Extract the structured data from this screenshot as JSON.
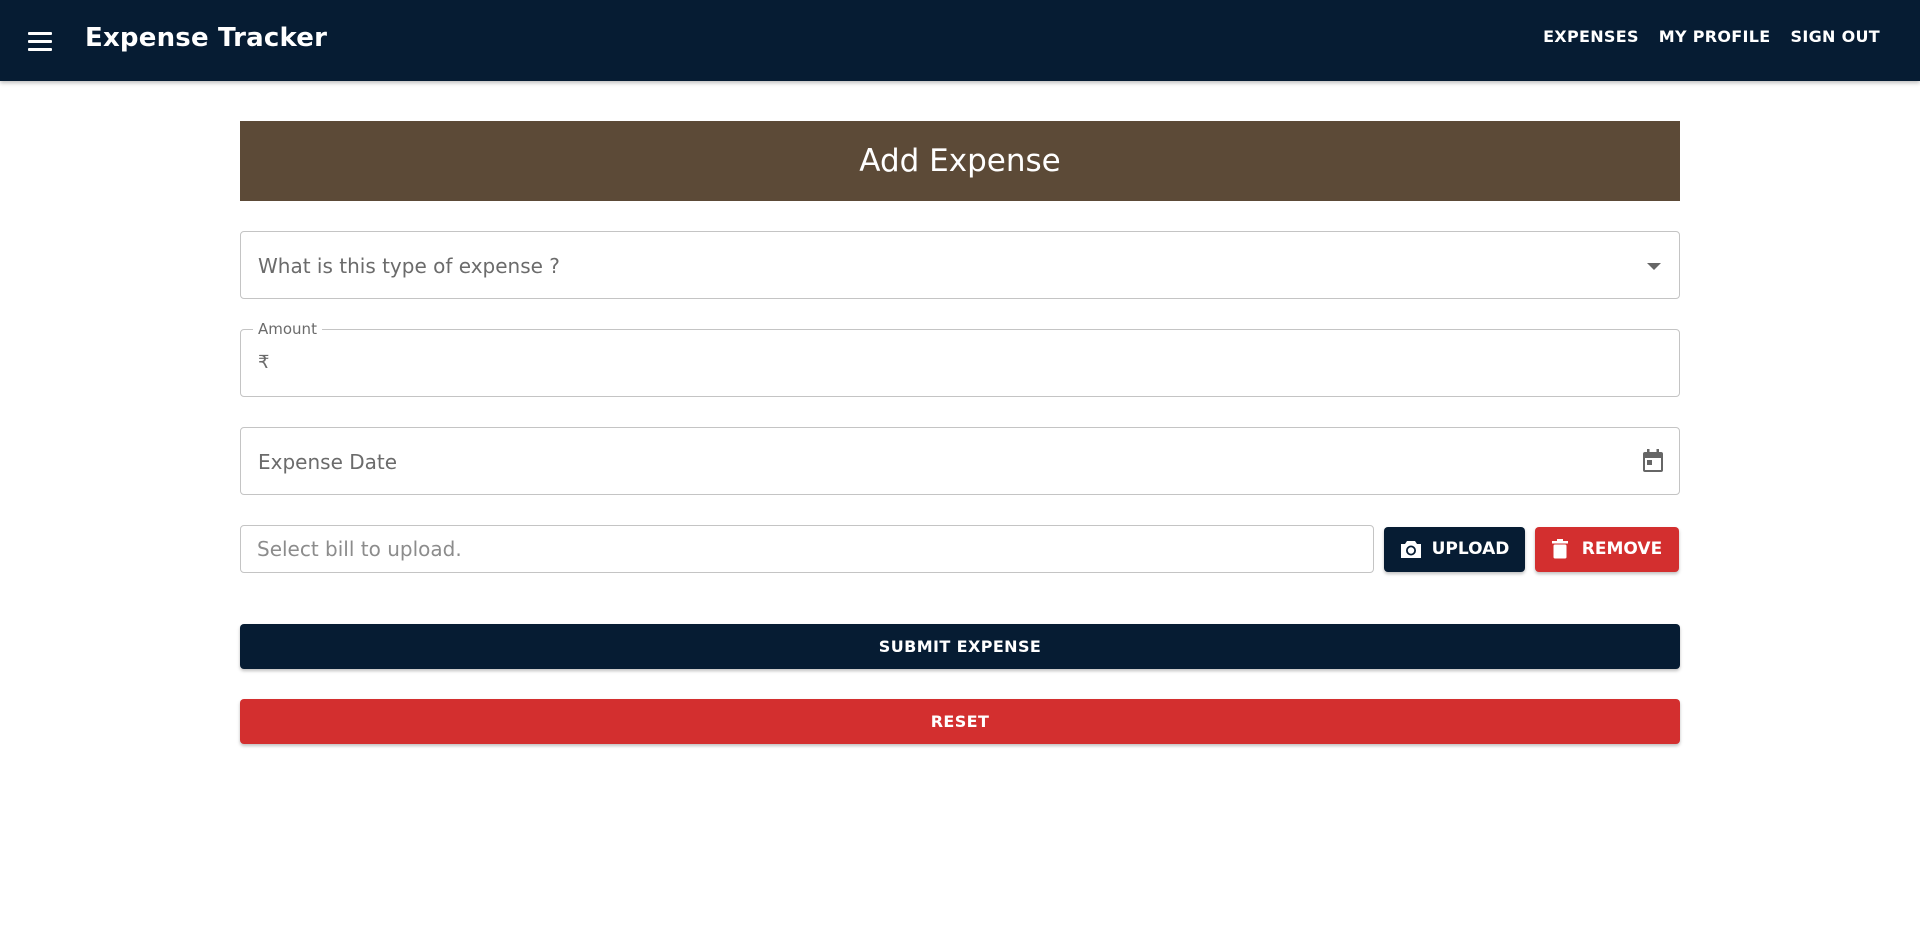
{
  "appbar": {
    "title": "Expense Tracker",
    "nav": [
      "EXPENSES",
      "MY PROFILE",
      "SIGN OUT"
    ],
    "background": "#061c33"
  },
  "form": {
    "heading": "Add Expense",
    "heading_background": "#5c4a37",
    "expense_type_placeholder": "What is this type of expense ?",
    "amount_label": "Amount",
    "amount_prefix": "₹",
    "amount_value": "",
    "date_placeholder": "Expense Date",
    "bill_placeholder": "Select bill to upload.",
    "upload_label": "UPLOAD",
    "remove_label": "REMOVE",
    "submit_label": "SUBMIT EXPENSE",
    "reset_label": "RESET",
    "accent_danger": "#d32f2f"
  },
  "icons": {
    "menu": "menu-icon",
    "dropdown": "arrow-drop-down-icon",
    "calendar": "calendar-icon",
    "camera": "camera-icon",
    "trash": "trash-icon"
  }
}
